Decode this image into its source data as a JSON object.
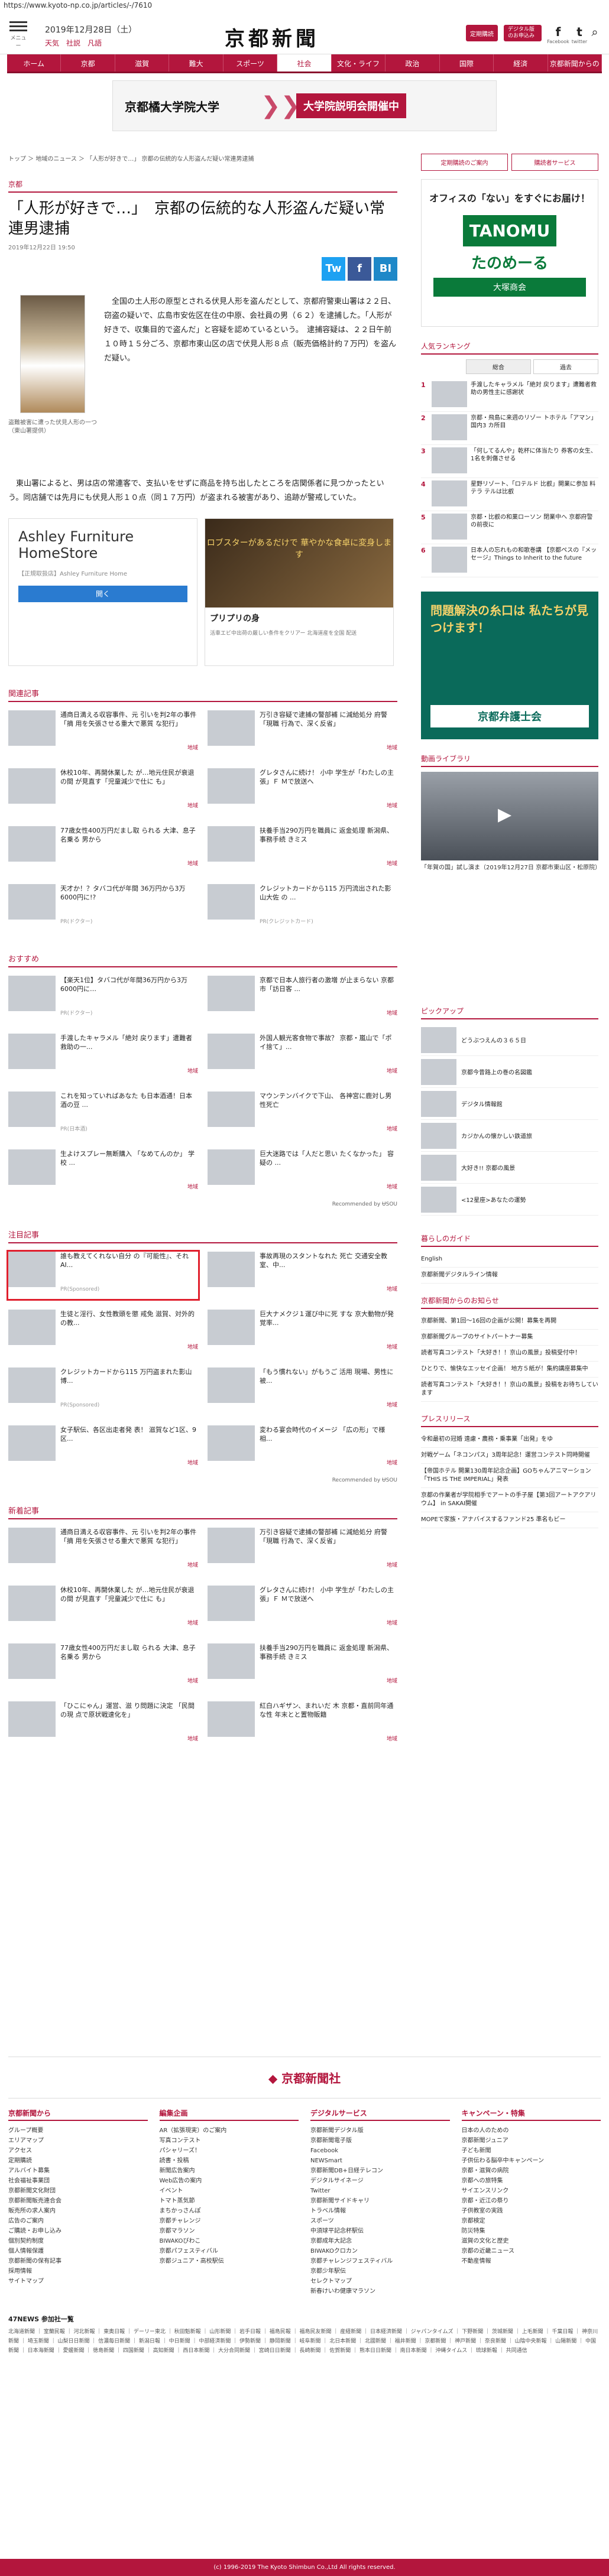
{
  "url": "https://www.kyoto-np.co.jp/articles/-/7610",
  "header": {
    "menu": "メニュー",
    "date": "2019年12月28日（土）",
    "weather": [
      "天気",
      "社説",
      "凡語"
    ],
    "logo": "京都新聞",
    "btn1": "定期購読",
    "btn2": "デジタル版のお申込み",
    "fb": "f",
    "tw": "t",
    "search": "⌕",
    "fb_l": "Facebook",
    "tw_l": "twitter"
  },
  "nav": [
    "ホーム",
    "京都",
    "滋賀",
    "難大",
    "スポーツ",
    "社会",
    "文化・ライフ",
    "政治",
    "国際",
    "経済",
    "京都新聞からの"
  ],
  "banner": {
    "l": "京都橘大学院大学",
    "r": "大学院説明会開催中"
  },
  "crumb": "トップ ＞ 地域のニュース ＞ 「人形が好きで…」 京都の伝統的な人形盗んだ疑い常連男逮捕",
  "section": "京都",
  "article": {
    "title": "「人形が好きで…」　京都の伝統的な人形盗んだ疑い常連男逮捕",
    "date": "2019年12月22日 19:50",
    "caption": "盗難被害に遭った伏見人形の一つ（東山署提供）",
    "p1": "全国の土人形の原型とされる伏見人形を盗んだとして、京都府警東山署は２２日、窃盗の疑いで、広島市安佐区在住の中原、会社員の男（６２）を逮捕した。「人形が好きで、収集目的で盗んだ」と容疑を認めているという。　逮捕容疑は、２２日午前１０時１５分ごろ、京都市東山区の店で伏見人形８点（販売価格計約７万円）を盗んだ疑い。",
    "p2": "東山署によると、男は店の常連客で、支払いをせずに商品を持ち出したところを店関係者に見つかったという。同店舗では先月にも伏見人形１０点（同１７万円）が盗まれる被害があり、追跡が警戒していた。"
  },
  "share": [
    "Tw",
    "f",
    "BI"
  ],
  "ads": {
    "a1": "Ashley Furniture HomeStore",
    "a1s": "【正規取扱店】Ashley Furniture Home",
    "a1b": "開く",
    "a2": "ロブスターがあるだけで 華やかな食卓に変身します",
    "a2t": "プリプリの身",
    "a2d": "活車エビ中出荷の厳しい条件をクリアー 北海道産を全国 配送"
  },
  "related": {
    "h": "関連記事",
    "items": [
      {
        "t": "通商日満える収容事件、元 引いを判2年の事件「摘 用を矢張させる重大で悪質 な犯行」",
        "g": "地域"
      },
      {
        "t": "万引き容疑で逮捕の警部補 に減給処分 府警「現職 行為で、深く反省」",
        "g": "地域"
      },
      {
        "t": "休校10年、再開休業した が…地元住民が衰退の間 が見直す「児童減少で仕に も」",
        "g": "地域"
      },
      {
        "t": "グレタさんに続け！ 小中 学生が「わたしの主張」Ｆ Ｍで放送へ",
        "g": "地域"
      },
      {
        "t": "77歳女性400万円だまし取 られる 大津、息子名乗る 男から",
        "g": "地域"
      },
      {
        "t": "扶養手当290万円を職員に 返金処理 新潟県、事務手続 きミス",
        "g": "地域"
      },
      {
        "t": "天才か！？タバコ代が年間 36万円から3万6000円に!?",
        "g": "PR(ドクター)"
      },
      {
        "t": "クレジットカードから115 万円流出された影山大佐 の ...",
        "g": "PR(クレジットカード)"
      }
    ]
  },
  "recommend": {
    "h": "おすすめ",
    "items": [
      {
        "t": "【楽天1位】タバコ代が年間36万円から3万6000円に…",
        "g": "PR(ドクター)"
      },
      {
        "t": "京都で日本人旅行者の激増 が止まらない 京都市「訪日客 ...",
        "g": "地域"
      },
      {
        "t": "手渡したキャラメル「絶対 戻ります」遭難者救助の一...",
        "g": "地域"
      },
      {
        "t": "外国人観光客食物で事故？ 京都・嵐山で「ポイ捨て」...",
        "g": "地域"
      },
      {
        "t": "これを知っていればあなた も日本酒通！日本酒の豆 ...",
        "g": "PR(日本酒)"
      },
      {
        "t": "マウンテンバイクで下山、 各神宮に鹿対し男性死亡",
        "g": "地域"
      },
      {
        "t": "生よけスプレー無断購入 「なめてんのか」 学校 ...",
        "g": "地域"
      },
      {
        "t": "巨大迷路では「人だと思い たくなかった」 容疑の ...",
        "g": "地域"
      }
    ],
    "by": "Recommended by ɄSOU"
  },
  "attention": {
    "h": "注目記事",
    "items": [
      {
        "t": "誰も教えてくれない自分 の『可能性』、それAI...",
        "g": "PR(Sponsored)"
      },
      {
        "t": "事故再現のスタントなれた 死亡 交通安全教室、中...",
        "g": "地域"
      },
      {
        "t": "生徒と淫行、女性教頭を懲 戒免 滋賀、対外的の教...",
        "g": "地域"
      },
      {
        "t": "巨大ナメクジ１運び中に死 すな 京大動物が発覚率...",
        "g": "地域"
      },
      {
        "t": "クレジットカードから115 万円盗まれた影山博...",
        "g": "PR(Sponsored)"
      },
      {
        "t": "「もう慣れない」がもうご 活用 現場、男性に被...",
        "g": "地域"
      },
      {
        "t": "女子駅伝、各区出走者発 表！ 滋賀など1区、9区...",
        "g": "地域"
      },
      {
        "t": "変わる宴会時代のイメージ 「広の形」で様相...",
        "g": "地域"
      }
    ],
    "by": "Recommended by ɄSOU"
  },
  "newest": {
    "h": "新着記事",
    "items": [
      {
        "t": "通商日満える収容事件、元 引いを判2年の事件「摘 用を矢張させる重大で悪質 な犯行」",
        "g": "地域"
      },
      {
        "t": "万引き容疑で逮捕の警部補 に減給処分 府警「現職 行為で、深く反省」",
        "g": "地域"
      },
      {
        "t": "休校10年、再開休業した が…地元住民が衰退の間 が見直す「児童減少で仕に も」",
        "g": "地域"
      },
      {
        "t": "グレタさんに続け！ 小中 学生が「わたしの主張」Ｆ Ｍで放送へ",
        "g": "地域"
      },
      {
        "t": "77歳女性400万円だまし取 られる 大津、息子名乗る 男から",
        "g": "地域"
      },
      {
        "t": "扶養手当290万円を職員に 返金処理 新潟県、事務手続 きミス",
        "g": "地域"
      },
      {
        "t": "「ひこにゃん」運営、滋 り問題に決定 「民間の現 点で原状戦速化を」",
        "g": "地域"
      },
      {
        "t": "紅白ハギザン、まれいだ 木 京都・直前同年通な性 年末とと置物販籍",
        "g": "地域"
      }
    ]
  },
  "side": {
    "b1": "定期購読のご案内",
    "b2": "購読者サービス",
    "ad": {
      "t1": "オフィスの「ない」をすぐにお届け！",
      "t2": "TANOMU",
      "t3": "たのめーる",
      "t4": "大塚商会"
    },
    "rank": {
      "h": "人気ランキング",
      "tabs": [
        "総合",
        "過去"
      ],
      "items": [
        "手渡したキャラメル「絶対 戻ります」遭難者救助の男性主に感謝状",
        "京都・飛島に来週のリゾー トホテル「アマン」 国内3 カ所目",
        "「何してるんや」乾杯に体当たり 券客の女生、1名を刺傷させる",
        "星野リゾート、「ロテルド 比叡」開業に参加 料テラ テルは比叡",
        "京都・比叡の和菓ローソン 閉業中へ 京都府警の前夜に",
        "日本人の忘れもの和歌巻講 【京都ペスの『メッセージ』Things to Inherit to the future"
      ]
    },
    "blue": {
      "t": "問題解決の糸口は 私たちが見つけます！",
      "bar": "京都弁護士会"
    },
    "video": {
      "h": "動画ライブラリ",
      "cap": "「年賀の国」試し演ま（2019年12月27日 京都市東山区・松原院）"
    },
    "pick": {
      "h": "ピックアップ",
      "items": [
        "どうぶつえんの３６５日",
        "京都今昔路上の巻の名図鑑",
        "デジタル情報館",
        "カジかんの懐かしい鉄道旅",
        "大好き!! 京都の風景",
        "<12星座>あなたの運勢"
      ]
    },
    "guide": {
      "h": "暮らしのガイド",
      "items": [
        "English",
        "京都新聞デジタルライン情報"
      ]
    },
    "notice": {
      "h": "京都新聞からのお知らせ",
      "items": [
        "京都新聞、第1回～16回の企画が公開！募集を再開",
        "京都新聞グループのサイトパートナー募集",
        "読者写真コンテスト「大好き！！京山の風景」投稿受付中！",
        "ひとりで、愉快なエッセイ企画！ 地方５紙が！集約講座募集中",
        "読者写真コンテスト「大好き！！京山の風景」投稿をお待ちしています"
      ]
    },
    "press": {
      "h": "プレスリリース",
      "items": [
        "令和最初の冠婚 遠慮・農務・乗事業「出発」をゆ",
        "対戦ゲーム「ネコンパス」3周年記念！運営コンテスト同時開催",
        "【帝国ホテル 開業130周年記念企画】GOちゃんアニマーション「THIS IS THE IMPERIAL」発表",
        "京都の作業者が学院相手でアートの手子屋【第3回アートアクアリウム】 in SAKAI開催",
        "MOPEで家族・アナバイスするファンド25 準名もビー"
      ]
    }
  },
  "footer": {
    "logo": "◆ 京都新聞社",
    "cols": [
      {
        "h": "京都新聞から",
        "items": [
          "グループ概要",
          "エリアマップ",
          "アクセス",
          "定期購読",
          "アルバイト募集",
          "社会福祉事業団",
          "京都新聞文化財団",
          "京都新聞販売連合会",
          "販売所の求人案内",
          "広告のご案内",
          "ご購読・お申し込み",
          "個別契約制度",
          "個人情報保護",
          "京都新聞の保有記事",
          "採用情報",
          "サイトマップ"
        ]
      },
      {
        "h": "編集企画",
        "items": [
          "AR（拡張現実）のご案内",
          "写真コンテスト",
          "パシャリーズ！",
          "読書・投稿",
          "新聞広告案内",
          "Web広告の案内",
          "",
          "イベント",
          "トマト蒸気節",
          "まちかっさんぽ",
          "京都チャレンジ",
          "京都マラソン",
          "BIWAKOびわこ",
          "京都パフェスティバル",
          "京都ジュニア・高校駅伝"
        ]
      },
      {
        "h": "デジタルサービス",
        "items": [
          "京都新聞デジタル版",
          "京都新聞電子版",
          "Facebook",
          "NEWSmart",
          "京都新聞DB+日経テレコン",
          "デジタルサイネージ",
          "Twitter",
          "京都新聞サイドキャリ",
          "トラベル情報",
          "",
          "スポーツ",
          "中須球平記念杯駅伝",
          "京都成年大記念",
          "BIWAKOクロカン",
          "京都チャレンジフェスティバル",
          "京都少年駅伝",
          "セレクトマップ",
          "新春けいわ健康マラソン"
        ]
      },
      {
        "h": "キャンペーン・特集",
        "items": [
          "日本の人のための",
          "京都新聞ジュニア",
          "子ども新聞",
          "子供伝わる脳卒中キャンペーン",
          "京都・滋賀の病院",
          "京都への旅特集",
          "サイエンスリンク",
          "京都・近江の祭り",
          "子供教室の実践",
          "京都検定",
          "防災特集",
          "滋賀の文化と歴史",
          "京都の近畿ニュース",
          "不動産情報"
        ]
      }
    ],
    "n47": "47NEWS 参加社一覧",
    "n47list": "北海道新聞 ｜ 室蘭民報 ｜ 河北新報 ｜ 東奥日報 ｜ デーリー東北 ｜ 秋田魁新報 ｜ 山形新聞 ｜ 岩手日報 ｜ 福島民報 ｜ 福島民友新聞 ｜ 産経新聞 ｜ 日本経済新聞 ｜ ジャパンタイムズ ｜ 下野新聞 ｜ 茨城新聞 ｜ 上毛新聞 ｜ 千葉日報 ｜ 神奈川新聞 ｜ 埼玉新聞 ｜ 山梨日日新聞 ｜ 信濃毎日新聞 ｜ 新潟日報 ｜ 中日新聞 ｜ 中部経済新聞 ｜ 伊勢新聞 ｜ 静岡新聞 ｜ 岐阜新聞 ｜ 北日本新聞 ｜ 北國新聞 ｜ 福井新聞 ｜ 京都新聞 ｜ 神戸新聞 ｜ 奈良新聞 ｜ 山陰中央新報 ｜ 山陽新聞 ｜ 中国新聞 ｜ 日本海新聞 ｜ 愛媛新聞 ｜ 徳島新聞 ｜ 四国新聞 ｜ 高知新聞 ｜ 西日本新聞 ｜ 大分合同新聞 ｜ 宮崎日日新聞 ｜ 長崎新聞 ｜ 佐賀新聞 ｜ 熊本日日新聞 ｜ 南日本新聞 ｜ 沖縄タイムス ｜ 琉球新報 ｜ 共同通信",
    "copy": "(c) 1996-2019 The Kyoto Shimbun Co.,Ltd All rights reserved."
  }
}
